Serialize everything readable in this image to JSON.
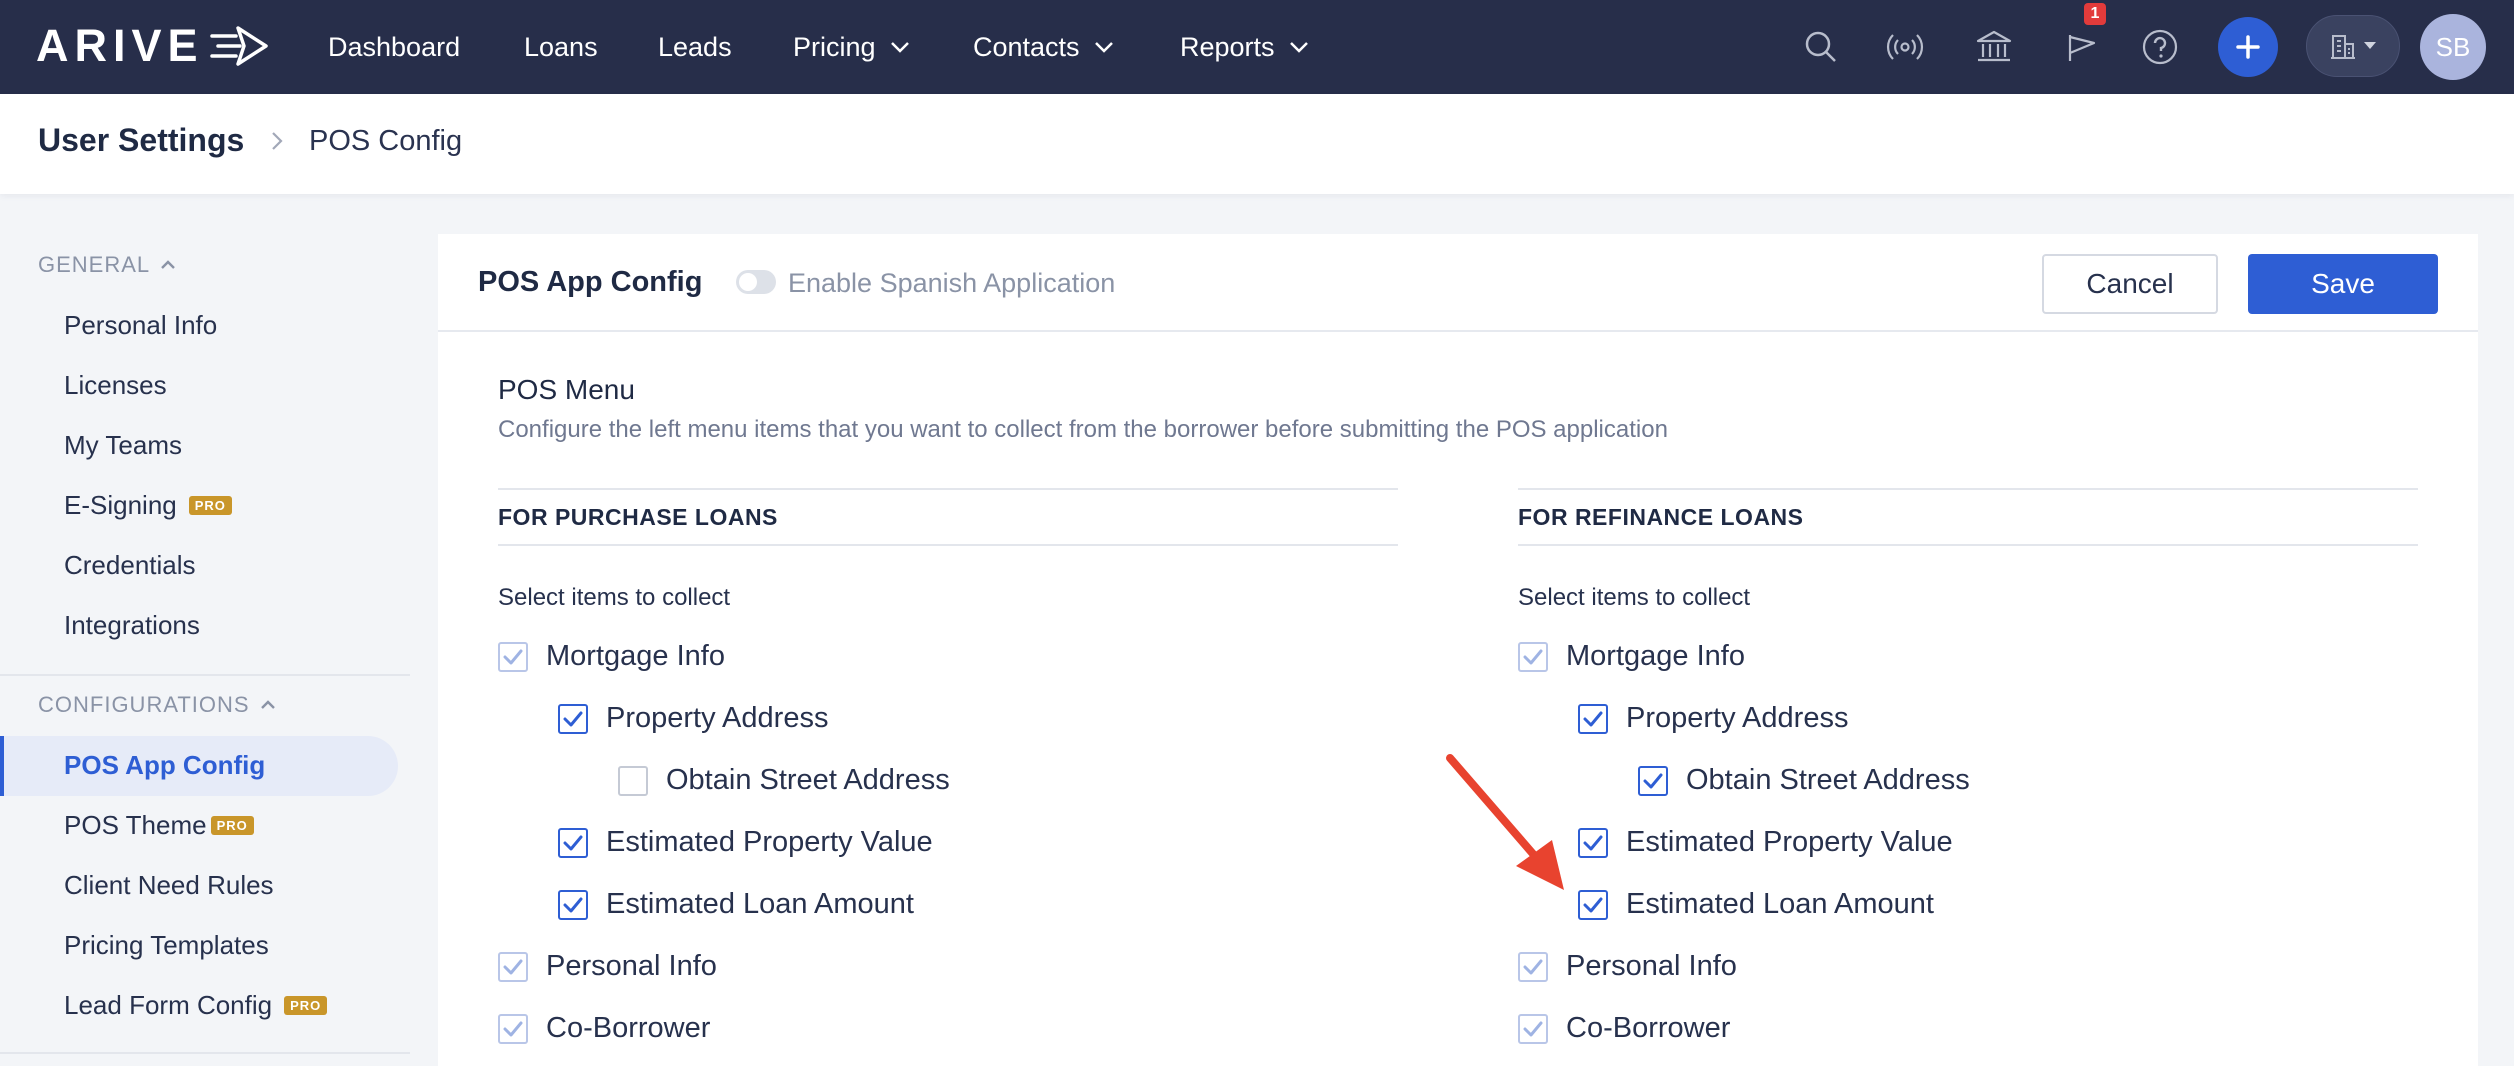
{
  "brand": {
    "logo_text": "ARIVE"
  },
  "nav": {
    "items": [
      {
        "label": "Dashboard"
      },
      {
        "label": "Loans"
      },
      {
        "label": "Leads"
      },
      {
        "label": "Pricing"
      },
      {
        "label": "Contacts"
      },
      {
        "label": "Reports"
      }
    ],
    "notification_count": "1",
    "avatar_initials": "SB",
    "icons": [
      "search-icon",
      "broadcast-icon",
      "bank-icon",
      "announcement-icon",
      "help-icon",
      "plus-icon",
      "building-icon"
    ]
  },
  "breadcrumb": {
    "root": "User Settings",
    "current": "POS Config"
  },
  "sidebar": {
    "sections": [
      {
        "label": "GENERAL",
        "items": [
          {
            "label": "Personal Info"
          },
          {
            "label": "Licenses"
          },
          {
            "label": "My Teams"
          },
          {
            "label": "E-Signing",
            "badge": "PRO"
          },
          {
            "label": "Credentials"
          },
          {
            "label": "Integrations"
          }
        ]
      },
      {
        "label": "CONFIGURATIONS",
        "items": [
          {
            "label": "POS App Config",
            "active": true
          },
          {
            "label": "POS Theme",
            "badge": "PRO"
          },
          {
            "label": "Client Need Rules"
          },
          {
            "label": "Pricing Templates"
          },
          {
            "label": "Lead Form Config",
            "badge": "PRO"
          }
        ]
      }
    ]
  },
  "card": {
    "title": "POS App Config",
    "toggle_label": "Enable Spanish Application",
    "cancel_label": "Cancel",
    "save_label": "Save",
    "section_title": "POS Menu",
    "section_desc": "Configure the left menu items that you want to collect from the borrower before submitting the POS application",
    "purchase": {
      "heading": "FOR PURCHASE LOANS",
      "sub": "Select items to collect",
      "items": [
        {
          "label": "Mortgage Info",
          "state": "checked-disabled"
        },
        {
          "label": "Property Address",
          "state": "checked"
        },
        {
          "label": "Obtain Street Address",
          "state": "unchecked"
        },
        {
          "label": "Estimated Property Value",
          "state": "checked"
        },
        {
          "label": "Estimated Loan Amount",
          "state": "checked"
        },
        {
          "label": "Personal Info",
          "state": "checked-disabled"
        },
        {
          "label": "Co-Borrower",
          "state": "checked-disabled"
        }
      ]
    },
    "refinance": {
      "heading": "FOR REFINANCE LOANS",
      "sub": "Select items to collect",
      "items": [
        {
          "label": "Mortgage Info",
          "state": "checked-disabled"
        },
        {
          "label": "Property Address",
          "state": "checked"
        },
        {
          "label": "Obtain Street Address",
          "state": "checked"
        },
        {
          "label": "Estimated Property Value",
          "state": "checked"
        },
        {
          "label": "Estimated Loan Amount",
          "state": "checked"
        },
        {
          "label": "Personal Info",
          "state": "checked-disabled"
        },
        {
          "label": "Co-Borrower",
          "state": "checked-disabled"
        }
      ]
    }
  },
  "colors": {
    "nav_bg": "#272e4a",
    "accent": "#2e5ed4",
    "pro_badge": "#c9962a",
    "annotation_arrow": "#e8432f"
  }
}
